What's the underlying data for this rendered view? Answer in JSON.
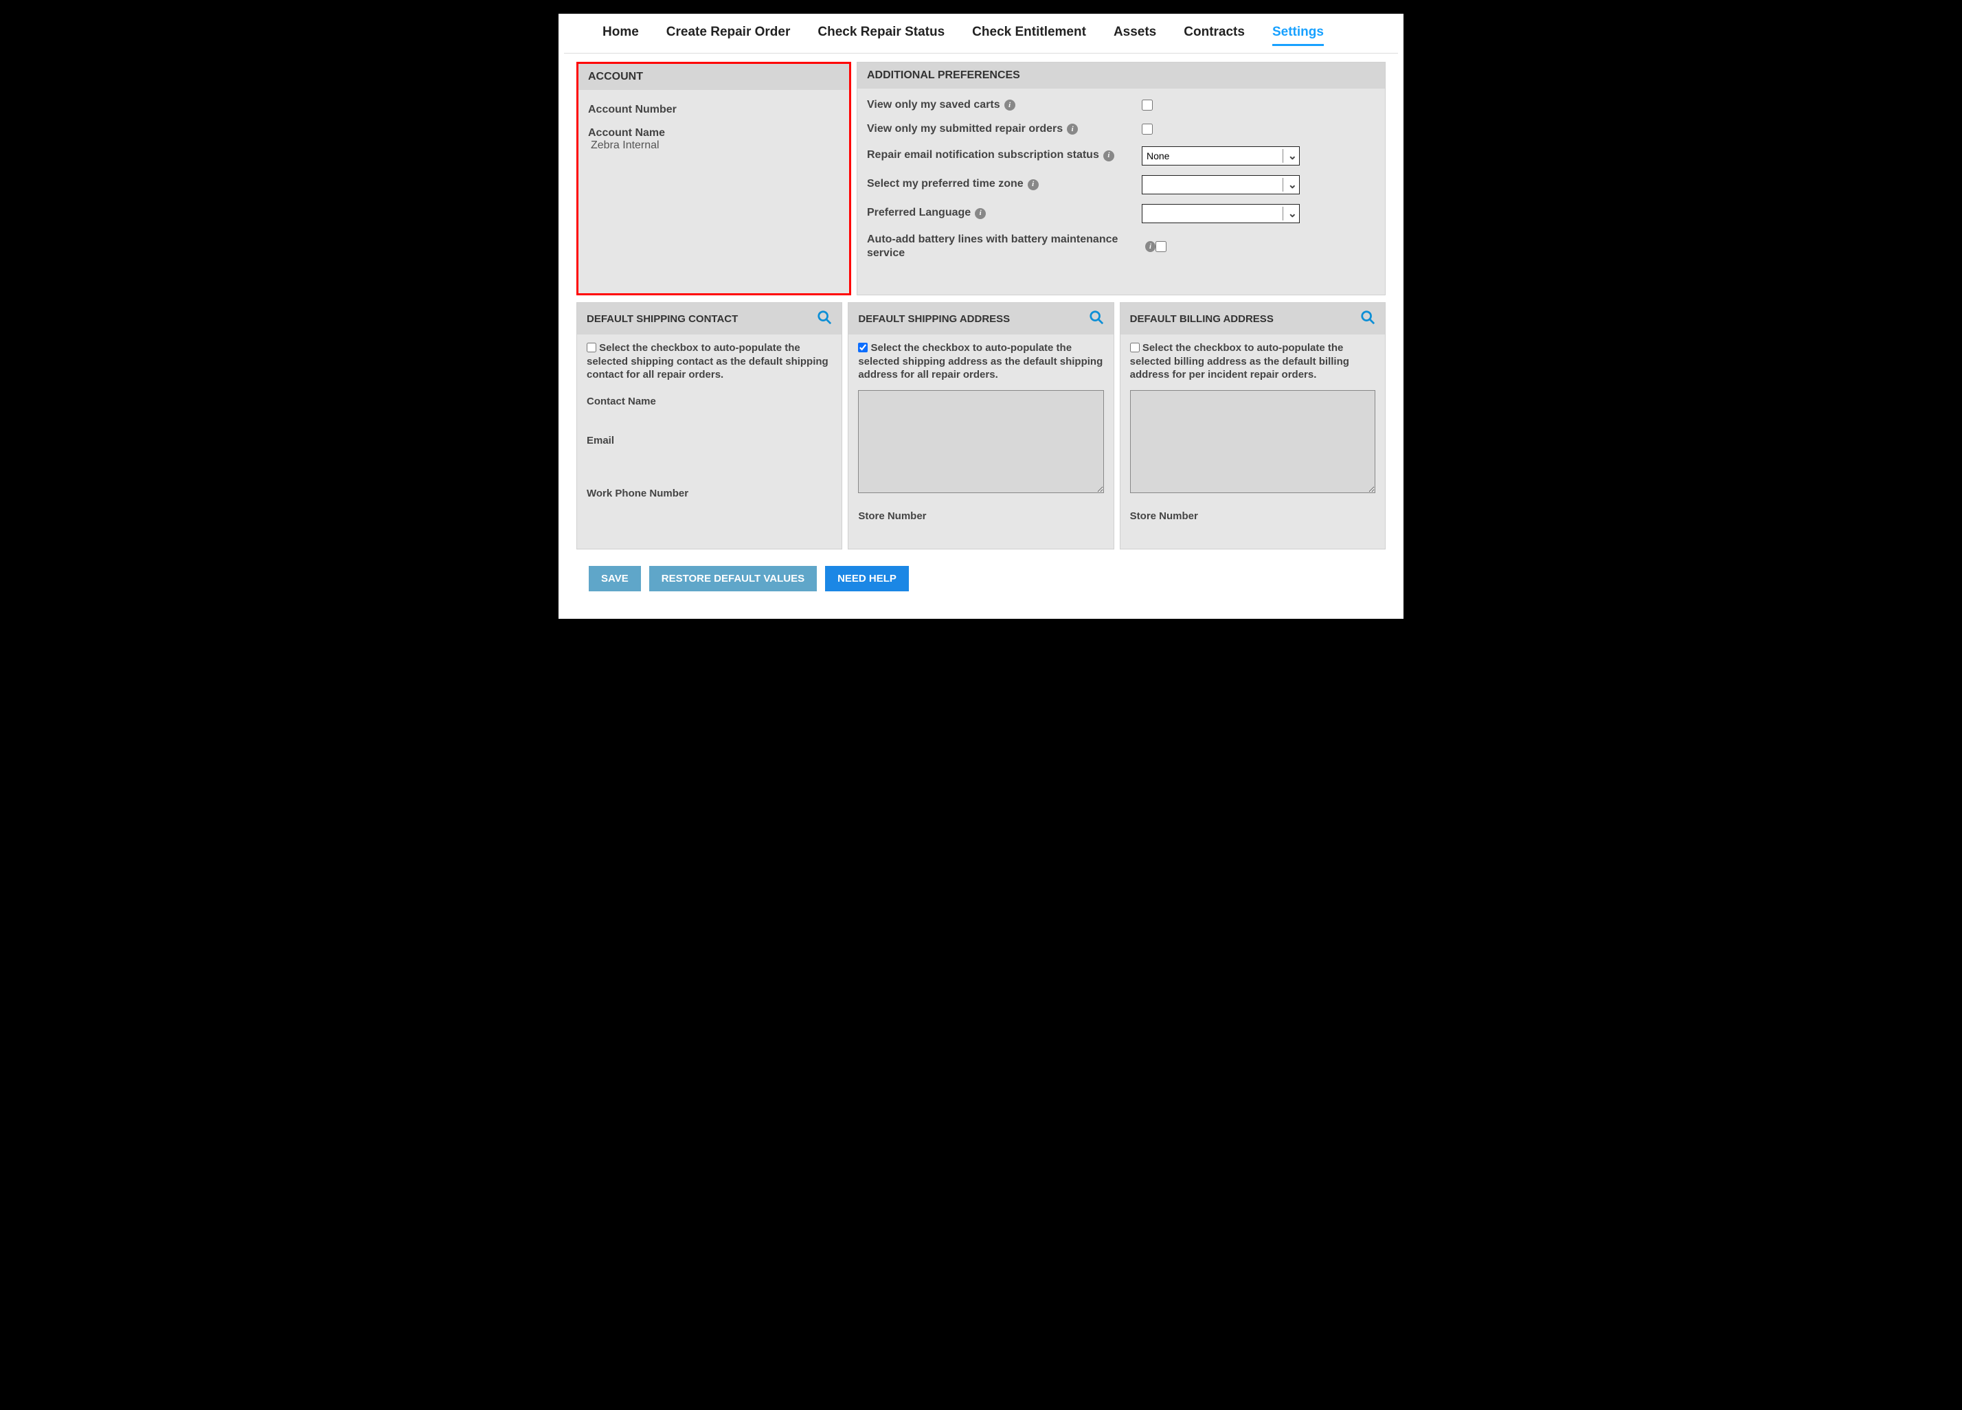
{
  "nav": {
    "items": [
      "Home",
      "Create Repair Order",
      "Check Repair Status",
      "Check Entitlement",
      "Assets",
      "Contracts",
      "Settings"
    ],
    "activeIndex": 6
  },
  "account": {
    "header": "ACCOUNT",
    "numberLabel": "Account Number",
    "numberValue": "",
    "nameLabel": "Account Name",
    "nameValue": "Zebra Internal"
  },
  "prefs": {
    "header": "ADDITIONAL PREFERENCES",
    "viewCarts": {
      "label": "View only my saved carts",
      "checked": false
    },
    "viewOrders": {
      "label": "View only my submitted repair orders",
      "checked": false
    },
    "emailSub": {
      "label": "Repair email notification subscription status",
      "value": "None"
    },
    "timezone": {
      "label": "Select my preferred time zone",
      "value": ""
    },
    "language": {
      "label": "Preferred Language",
      "value": ""
    },
    "autoBattery": {
      "label": "Auto-add battery lines with battery maintenance service",
      "checked": false
    }
  },
  "shippingContact": {
    "header": "DEFAULT SHIPPING CONTACT",
    "autoText": "Select the checkbox to auto-populate the selected shipping contact as the default shipping contact for all repair orders.",
    "autoChecked": false,
    "contactNameLabel": "Contact Name",
    "emailLabel": "Email",
    "phoneLabel": "Work Phone Number"
  },
  "shippingAddress": {
    "header": "DEFAULT SHIPPING ADDRESS",
    "autoText": "Select the checkbox to auto-populate the selected shipping address as the default shipping address for all repair orders.",
    "autoChecked": true,
    "addressValue": "",
    "storeLabel": "Store Number"
  },
  "billingAddress": {
    "header": "DEFAULT BILLING ADDRESS",
    "autoText": "Select the checkbox to auto-populate the selected billing address as the default billing address for per incident repair orders.",
    "autoChecked": false,
    "addressValue": "",
    "storeLabel": "Store Number"
  },
  "buttons": {
    "save": "SAVE",
    "restore": "RESTORE DEFAULT VALUES",
    "help": "NEED HELP"
  }
}
